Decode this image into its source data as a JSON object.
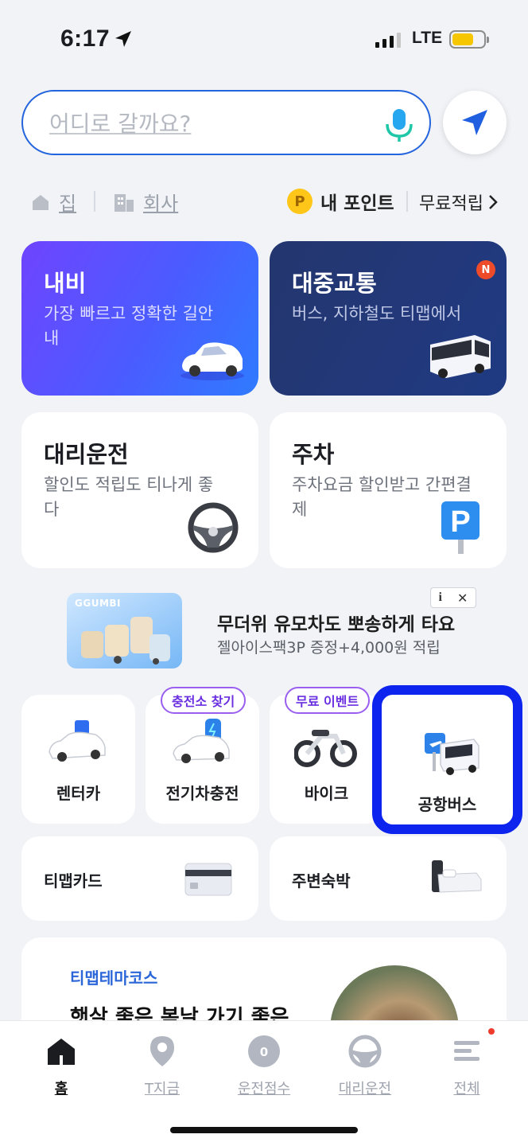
{
  "status": {
    "time": "6:17",
    "network": "LTE"
  },
  "search": {
    "placeholder": "어디로 갈까요?"
  },
  "shortcuts": {
    "home": "집",
    "office": "회사"
  },
  "points": {
    "coin": "P",
    "label": "내 포인트",
    "free": "무료적립"
  },
  "cards": {
    "navi": {
      "title": "내비",
      "desc": "가장 빠르고 정확한 길안내"
    },
    "transit": {
      "title": "대중교통",
      "desc": "버스, 지하철도 티맵에서",
      "badge": "N"
    },
    "driver": {
      "title": "대리운전",
      "desc": "할인도 적립도 티나게 좋다"
    },
    "parking": {
      "title": "주차",
      "desc": "주차요금 할인받고 간편결제"
    }
  },
  "ad": {
    "brand": "GGUMBI",
    "title": "무더위 유모차도 뽀송하게 타요",
    "subtitle": "젤아이스팩3P 증정+4,000원 적립"
  },
  "tiles": [
    {
      "label": "렌터카"
    },
    {
      "label": "전기차충전",
      "tag": "충전소 찾기"
    },
    {
      "label": "바이크",
      "tag": "무료 이벤트"
    },
    {
      "label": "공항버스"
    }
  ],
  "wide_tiles": [
    {
      "label": "티맵카드"
    },
    {
      "label": "주변숙박"
    }
  ],
  "theme": {
    "tag": "티맵테마코스",
    "title": "햇살 좋은 봄날 가기 좋은"
  },
  "tabbar": [
    {
      "label": "홈",
      "icon": "home-icon",
      "active": true
    },
    {
      "label": "T지금",
      "icon": "pin-icon"
    },
    {
      "label": "운전점수",
      "icon": "gauge-icon",
      "gauge": "0"
    },
    {
      "label": "대리운전",
      "icon": "steering-wheel-icon"
    },
    {
      "label": "전체",
      "icon": "menu-icon"
    }
  ],
  "colors": {
    "accent": "#2464dd",
    "highlight": "#0d24ee",
    "navi": "#5a4bff",
    "transit": "#223a7a"
  }
}
